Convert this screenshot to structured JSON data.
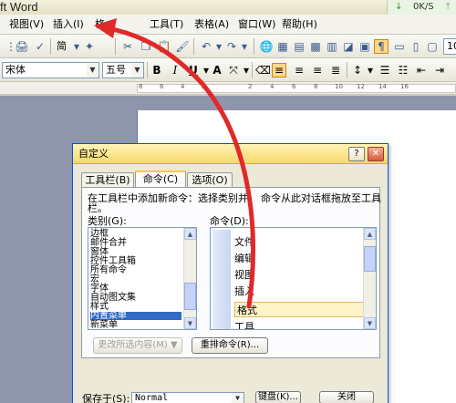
{
  "window": {
    "title": "ft Word"
  },
  "speed": {
    "down_icon": "↓",
    "rate": "0K/S",
    "up_icon": "↑"
  },
  "menu": [
    "视图(V)",
    "插入(I)",
    "格",
    "工具(T)",
    "表格(A)",
    "窗口(W)",
    "帮助(H)"
  ],
  "toolbar": {
    "style_label": "简",
    "zoom_value": "10"
  },
  "format": {
    "font_name": "宋体",
    "font_size": "五号",
    "bold": "B",
    "italic": "I",
    "underline": "U",
    "font_color": "A"
  },
  "ruler": {
    "numbers": [
      "8",
      "6",
      "4",
      "2",
      "2",
      "4",
      "6",
      "8",
      "10",
      "12",
      "14",
      "16"
    ]
  },
  "dialog": {
    "title": "自定义",
    "help_btn": "?",
    "close_btn": "✕",
    "tabs": [
      {
        "label": "工具栏(B)",
        "active": false
      },
      {
        "label": "命令(C)",
        "active": true
      },
      {
        "label": "选项(O)",
        "active": false
      }
    ],
    "instruction_line1": "在工具栏中添加新命令：选择类别并",
    "instruction_line1b": "命令从此对话框拖放至工具",
    "instruction_line2": "栏。",
    "categories_label": "类别(G):",
    "commands_label": "命令(D):",
    "categories": [
      "边框",
      "邮件合并",
      "窗体",
      "控件工具箱",
      "所有命令",
      "宏",
      "字体",
      "自动图文集",
      "样式",
      "内置菜单",
      "新菜单"
    ],
    "selected_category": "内置菜单",
    "commands": [
      {
        "label": "文件",
        "highlight": false
      },
      {
        "label": "编辑",
        "highlight": false
      },
      {
        "label": "视图",
        "highlight": false
      },
      {
        "label": "插入",
        "highlight": false
      },
      {
        "label": "格式",
        "highlight": true
      },
      {
        "label": "工具",
        "highlight": false
      }
    ],
    "modify_btn": "更改所选内容(M) ▼",
    "rearrange_btn": "重排命令(R)...",
    "save_in_label": "保存于(S):",
    "save_in_value": "Normal",
    "keyboard_btn": "键盘(K)...",
    "close_dialog_btn": "关闭"
  },
  "colors": {
    "arrow": "#e02a2a",
    "dialog_title_gradient_top": "#fff3b8",
    "dialog_title_gradient_bottom": "#f6d96a",
    "selection": "#316ac5",
    "document_background": "#8f96ac"
  }
}
